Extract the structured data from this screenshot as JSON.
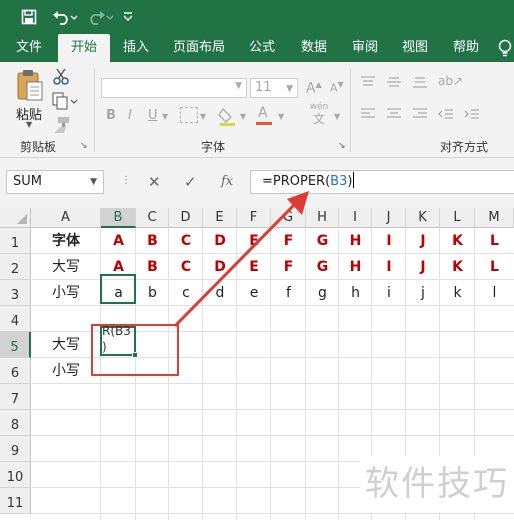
{
  "tabs": [
    "文件",
    "开始",
    "插入",
    "页面布局",
    "公式",
    "数据",
    "审阅",
    "视图",
    "帮助"
  ],
  "active_tab": "开始",
  "ribbon": {
    "paste_label": "粘贴",
    "clipboard_label": "剪贴板",
    "font_label": "字体",
    "align_label": "对齐方式",
    "font_size": "11",
    "bold": "B",
    "italic": "I",
    "underline": "U",
    "phonetic": "wén",
    "phonetic_char": "文"
  },
  "formula_bar": {
    "name_box": "SUM",
    "cancel": "✕",
    "enter": "✓",
    "fx": "fx",
    "formula_prefix": "=PROPER(",
    "formula_ref": "B3",
    "formula_suffix": ")"
  },
  "columns": [
    "A",
    "B",
    "C",
    "D",
    "E",
    "F",
    "G",
    "H",
    "I",
    "J",
    "K",
    "L",
    "M"
  ],
  "rows": [
    "1",
    "2",
    "3",
    "4",
    "5",
    "6",
    "7",
    "8",
    "9",
    "10",
    "11"
  ],
  "cells": {
    "row1": {
      "A": "字体",
      "letters": [
        "A",
        "B",
        "C",
        "D",
        "E",
        "F",
        "G",
        "H",
        "I",
        "J",
        "K",
        "L"
      ]
    },
    "row2": {
      "A": "大写",
      "letters": [
        "A",
        "B",
        "C",
        "D",
        "E",
        "F",
        "G",
        "H",
        "I",
        "J",
        "K",
        "L"
      ]
    },
    "row3": {
      "A": "小写",
      "letters": [
        "a",
        "b",
        "c",
        "d",
        "e",
        "f",
        "g",
        "h",
        "i",
        "j",
        "k",
        "l"
      ]
    },
    "row5": {
      "A": "大写",
      "B_edit_line1": "R(B3",
      "B_edit_line2": ")"
    },
    "row6": {
      "A": "小写"
    }
  },
  "watermark": "软件技巧",
  "colors": {
    "excel_green": "#217346",
    "letter_red": "#c00000",
    "annotation_red": "#d9403a",
    "ref_blue": "#1f6fc5"
  }
}
